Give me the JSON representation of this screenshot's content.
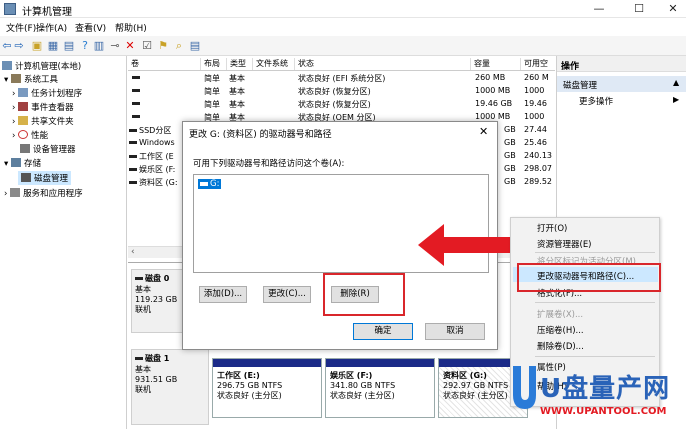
{
  "window": {
    "title": "计算机管理",
    "min": "—",
    "max": "☐",
    "close": "✕"
  },
  "menu": [
    "文件(F)",
    "操作(A)",
    "查看(V)",
    "帮助(H)"
  ],
  "tree": {
    "root": "计算机管理(本地)",
    "system_tools": "系统工具",
    "task_scheduler": "任务计划程序",
    "event_viewer": "事件查看器",
    "shared_folders": "共享文件夹",
    "performance": "性能",
    "device_manager": "设备管理器",
    "storage": "存储",
    "disk_management": "磁盘管理",
    "services_apps": "服务和应用程序"
  },
  "volume_list": {
    "headers": [
      "卷",
      "布局",
      "类型",
      "文件系统",
      "状态",
      "容量",
      "可用空"
    ],
    "rows": [
      {
        "vol": "",
        "layout": "简单",
        "type": "基本",
        "fs": "",
        "status": "状态良好 (EFI 系统分区)",
        "cap": "260 MB",
        "free": "260 M"
      },
      {
        "vol": "",
        "layout": "简单",
        "type": "基本",
        "fs": "",
        "status": "状态良好 (恢复分区)",
        "cap": "1000 MB",
        "free": "1000"
      },
      {
        "vol": "",
        "layout": "简单",
        "type": "基本",
        "fs": "",
        "status": "状态良好 (恢复分区)",
        "cap": "19.46 GB",
        "free": "19.46"
      },
      {
        "vol": "",
        "layout": "简单",
        "type": "基本",
        "fs": "",
        "status": "状态良好 (OEM 分区)",
        "cap": "1000 MB",
        "free": "1000"
      },
      {
        "vol": "SSD分区",
        "layout": "",
        "type": "",
        "fs": "",
        "status": "",
        "cap": "GB",
        "free": "27.44"
      },
      {
        "vol": "Windows",
        "layout": "",
        "type": "",
        "fs": "",
        "status": "",
        "cap": "GB",
        "free": "25.46"
      },
      {
        "vol": "工作区 (E",
        "layout": "",
        "type": "",
        "fs": "",
        "status": "",
        "cap": "GB",
        "free": "240.13"
      },
      {
        "vol": "娱乐区 (F:",
        "layout": "",
        "type": "",
        "fs": "",
        "status": "",
        "cap": "GB",
        "free": "298.07"
      },
      {
        "vol": "资料区 (G:",
        "layout": "",
        "type": "",
        "fs": "",
        "status": "",
        "cap": "GB",
        "free": "289.52"
      }
    ]
  },
  "disks": {
    "disk0": {
      "name": "磁盘 0",
      "type": "基本",
      "size": "119.23 GB",
      "state": "联机"
    },
    "disk1": {
      "name": "磁盘 1",
      "type": "基本",
      "size": "931.51 GB",
      "state": "联机"
    },
    "partitions": [
      {
        "name": "工作区 (E:)",
        "size": "296.75 GB NTFS",
        "status": "状态良好 (主分区)"
      },
      {
        "name": "娱乐区 (F:)",
        "size": "341.80 GB NTFS",
        "status": "状态良好 (主分区)"
      },
      {
        "name": "资料区 (G:)",
        "size": "292.97 GB NTFS",
        "status": "状态良好 (主分区)"
      }
    ]
  },
  "actions": {
    "header": "操作",
    "section": "磁盘管理",
    "more": "更多操作"
  },
  "dialog": {
    "title": "更改 G: (资料区) 的驱动器号和路径",
    "close": "✕",
    "description": "可用下列驱动器号和路径访问这个卷(A):",
    "list_item": "G:",
    "add": "添加(D)...",
    "change": "更改(C)...",
    "remove": "删除(R)",
    "ok": "确定",
    "cancel": "取消"
  },
  "context_menu": {
    "items": [
      {
        "label": "打开(O)",
        "disabled": false
      },
      {
        "label": "资源管理器(E)",
        "disabled": false
      },
      {
        "label": "将分区标记为活动分区(M)",
        "disabled": true
      },
      {
        "label": "更改驱动器号和路径(C)...",
        "disabled": false
      },
      {
        "label": "格式化(F)...",
        "disabled": false
      },
      {
        "label": "扩展卷(X)...",
        "disabled": true
      },
      {
        "label": "压缩卷(H)...",
        "disabled": false
      },
      {
        "label": "删除卷(D)...",
        "disabled": false
      },
      {
        "label": "属性(P)",
        "disabled": false
      },
      {
        "label": "帮助(H)",
        "disabled": false
      }
    ]
  },
  "watermark": {
    "brand": "U盘量产网",
    "url": "WWW.UPANTOOL.COM"
  },
  "colors": {
    "selection": "#cce8ff",
    "highlight_red": "#d9262b",
    "stripe_blue": "#1b2a88",
    "accent": "#0078d7"
  }
}
